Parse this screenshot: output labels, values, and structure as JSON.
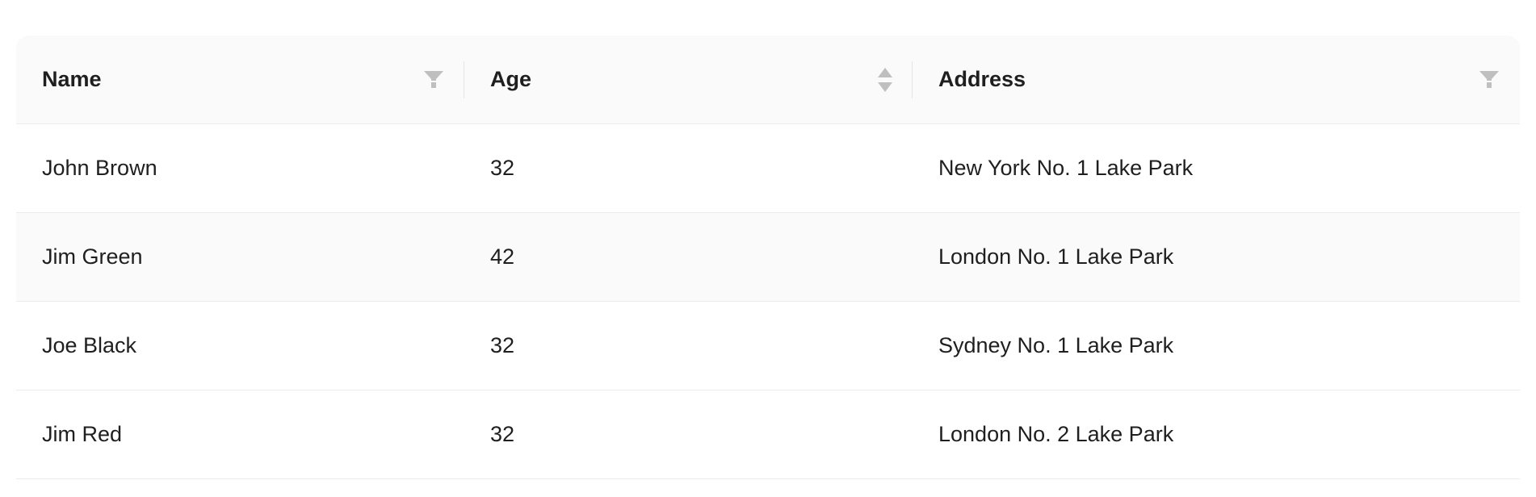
{
  "columns": {
    "name": "Name",
    "age": "Age",
    "address": "Address"
  },
  "icons": {
    "name_filter": "filter-icon",
    "age_sort": "sort-icon",
    "address_filter": "filter-icon"
  },
  "rows": [
    {
      "name": "John Brown",
      "age": "32",
      "address": "New York No. 1 Lake Park"
    },
    {
      "name": "Jim Green",
      "age": "42",
      "address": "London No. 1 Lake Park"
    },
    {
      "name": "Joe Black",
      "age": "32",
      "address": "Sydney No. 1 Lake Park"
    },
    {
      "name": "Jim Red",
      "age": "32",
      "address": "London No. 2 Lake Park"
    }
  ],
  "colors": {
    "header_bg": "#fafafa",
    "striped_row_bg": "#fafafa",
    "border": "#ececec",
    "icon": "#bfbfbf",
    "text": "#1f1f1f"
  }
}
